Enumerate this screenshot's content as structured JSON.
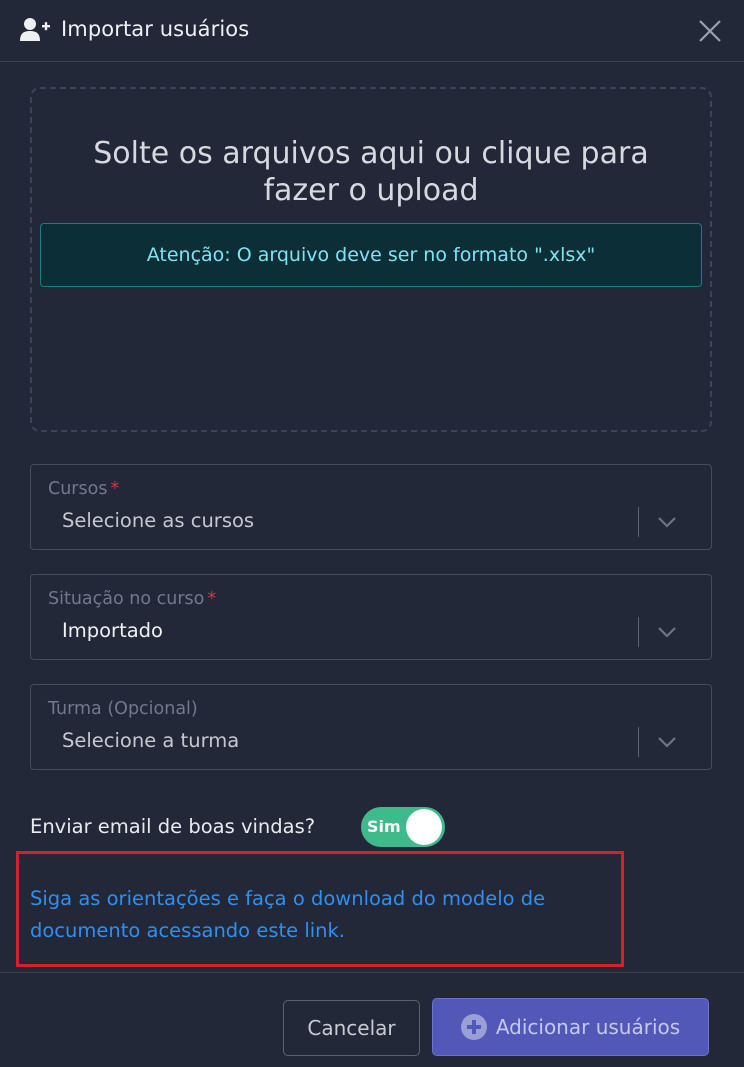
{
  "dialog": {
    "title": "Importar usuários",
    "header_icon": "user-plus-icon",
    "close_icon": "close-icon"
  },
  "dropzone": {
    "text": "Solte os arquivos aqui ou clique para fazer o upload",
    "alert": "Atenção: O arquivo deve ser no formato \".xlsx\""
  },
  "fields": {
    "cursos": {
      "label": "Cursos",
      "required_mark": "*",
      "value": "Selecione as cursos"
    },
    "situacao": {
      "label": "Situação no curso",
      "required_mark": "*",
      "value": "Importado"
    },
    "turma": {
      "label": "Turma (Opcional)",
      "value": "Selecione a turma"
    }
  },
  "welcome_email": {
    "label": "Enviar email de boas vindas?",
    "toggle_text": "Sim",
    "enabled": true
  },
  "doc_link": {
    "text": "Siga as orientações e faça o download do modelo de documento acessando este link."
  },
  "footer": {
    "cancel_label": "Cancelar",
    "add_label": "Adicionar usuários",
    "add_icon": "plus-circle-icon"
  },
  "colors": {
    "background": "#222838",
    "accent_button": "#5258b8",
    "toggle_on": "#3fba8a",
    "link": "#2f8ff2",
    "alert_text": "#7fe4f2",
    "required": "#e0313f",
    "highlight_border": "#d4212a"
  }
}
